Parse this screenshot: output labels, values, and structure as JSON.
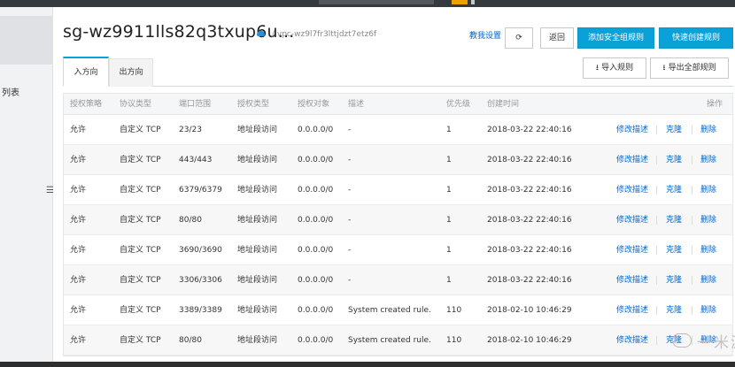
{
  "sidebar": {
    "partial_label": "列表"
  },
  "header": {
    "title": "sg-wz9911lls82q3txup6u...",
    "vpc": "/ vpc-wz9l7fr3lttjdzt7etz6f",
    "tutorial_label": "教我设置",
    "back_label": "返回",
    "add_rule_label": "添加安全组规则",
    "quick_rule_label": "快速创建规则"
  },
  "tabs": [
    {
      "label": "入方向"
    },
    {
      "label": "出方向"
    }
  ],
  "toolbar": {
    "import_label": "导入规则",
    "export_label": "导出全部规则"
  },
  "table": {
    "columns": [
      "授权策略",
      "协议类型",
      "端口范围",
      "授权类型",
      "授权对象",
      "描述",
      "优先级",
      "创建时间",
      "操作"
    ],
    "rows": [
      {
        "policy": "允许",
        "protocol": "自定义 TCP",
        "port": "23/23",
        "auth_type": "地址段访问",
        "auth_object": "0.0.0.0/0",
        "desc": "-",
        "priority": "1",
        "created": "2018-03-22 22:40:16"
      },
      {
        "policy": "允许",
        "protocol": "自定义 TCP",
        "port": "443/443",
        "auth_type": "地址段访问",
        "auth_object": "0.0.0.0/0",
        "desc": "-",
        "priority": "1",
        "created": "2018-03-22 22:40:16"
      },
      {
        "policy": "允许",
        "protocol": "自定义 TCP",
        "port": "6379/6379",
        "auth_type": "地址段访问",
        "auth_object": "0.0.0.0/0",
        "desc": "-",
        "priority": "1",
        "created": "2018-03-22 22:40:16"
      },
      {
        "policy": "允许",
        "protocol": "自定义 TCP",
        "port": "80/80",
        "auth_type": "地址段访问",
        "auth_object": "0.0.0.0/0",
        "desc": "-",
        "priority": "1",
        "created": "2018-03-22 22:40:16"
      },
      {
        "policy": "允许",
        "protocol": "自定义 TCP",
        "port": "3690/3690",
        "auth_type": "地址段访问",
        "auth_object": "0.0.0.0/0",
        "desc": "-",
        "priority": "1",
        "created": "2018-03-22 22:40:16"
      },
      {
        "policy": "允许",
        "protocol": "自定义 TCP",
        "port": "3306/3306",
        "auth_type": "地址段访问",
        "auth_object": "0.0.0.0/0",
        "desc": "-",
        "priority": "1",
        "created": "2018-03-22 22:40:16"
      },
      {
        "policy": "允许",
        "protocol": "自定义 TCP",
        "port": "3389/3389",
        "auth_type": "地址段访问",
        "auth_object": "0.0.0.0/0",
        "desc": "System created rule.",
        "priority": "110",
        "created": "2018-02-10 10:46:29"
      },
      {
        "policy": "允许",
        "protocol": "自定义 TCP",
        "port": "80/80",
        "auth_type": "地址段访问",
        "auth_object": "0.0.0.0/0",
        "desc": "System created rule.",
        "priority": "110",
        "created": "2018-02-10 10:46:29"
      }
    ],
    "actions": {
      "edit_label": "修改描述",
      "clone_label": "克隆",
      "delete_label": "删除"
    }
  },
  "watermark": {
    "text": "一米源码"
  },
  "colors": {
    "primary": "#0aa0d8",
    "link": "#0066cc"
  }
}
